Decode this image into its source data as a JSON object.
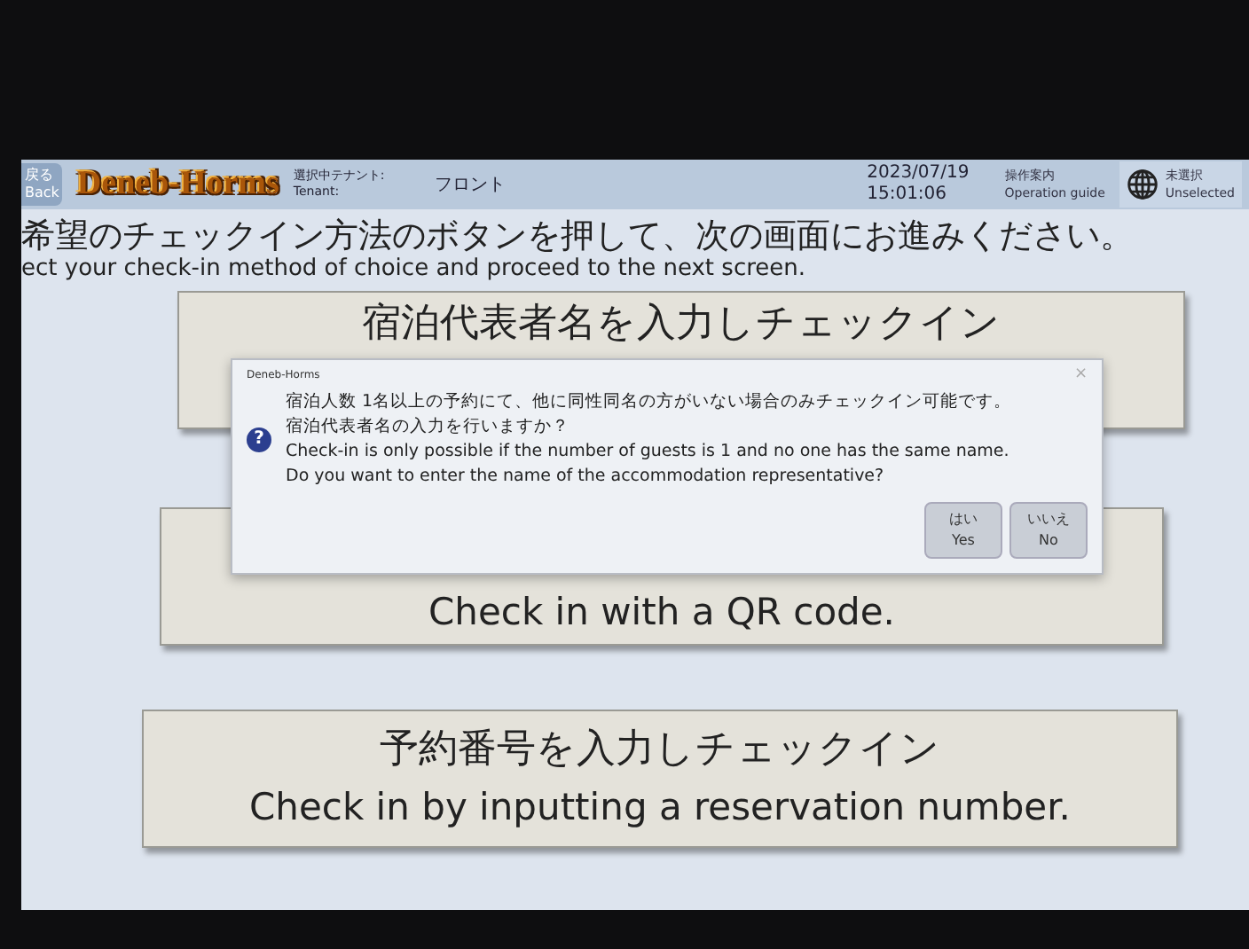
{
  "header": {
    "back": {
      "ja": "戻る",
      "en": "Back"
    },
    "logo": "Deneb-Horms",
    "tenant_label": {
      "ja": "選択中テナント:",
      "en": "Tenant:"
    },
    "tenant": "フロント",
    "date": "2023/07/19",
    "time": "15:01:06",
    "guide": {
      "ja": "操作案内",
      "en": "Operation guide"
    },
    "language": {
      "ja": "未選択",
      "en": "Unselected"
    }
  },
  "instruction": {
    "ja": "希望のチェックイン方法のボタンを押して、次の画面にお進みください。",
    "en": "ect your check-in method of choice and proceed to the next screen."
  },
  "options": [
    {
      "ja": "宿泊代表者名を入力しチェックイン"
    },
    {
      "en": "Check in with a QR code."
    },
    {
      "ja": "予約番号を入力しチェックイン",
      "en": "Check in by inputting a reservation number."
    }
  ],
  "dialog": {
    "title": "Deneb-Horms",
    "close": "×",
    "icon": "?",
    "lines": [
      "宿泊人数 1名以上の予約にて、他に同性同名の方がいない場合のみチェックイン可能です。",
      "宿泊代表者名の入力を行いますか？",
      "Check-in is only possible if the number of guests is 1 and no one has the same name.",
      "Do you want to enter the name of the accommodation representative?"
    ],
    "buttons": [
      {
        "ja": "はい",
        "en": "Yes"
      },
      {
        "ja": "いいえ",
        "en": "No"
      }
    ]
  }
}
